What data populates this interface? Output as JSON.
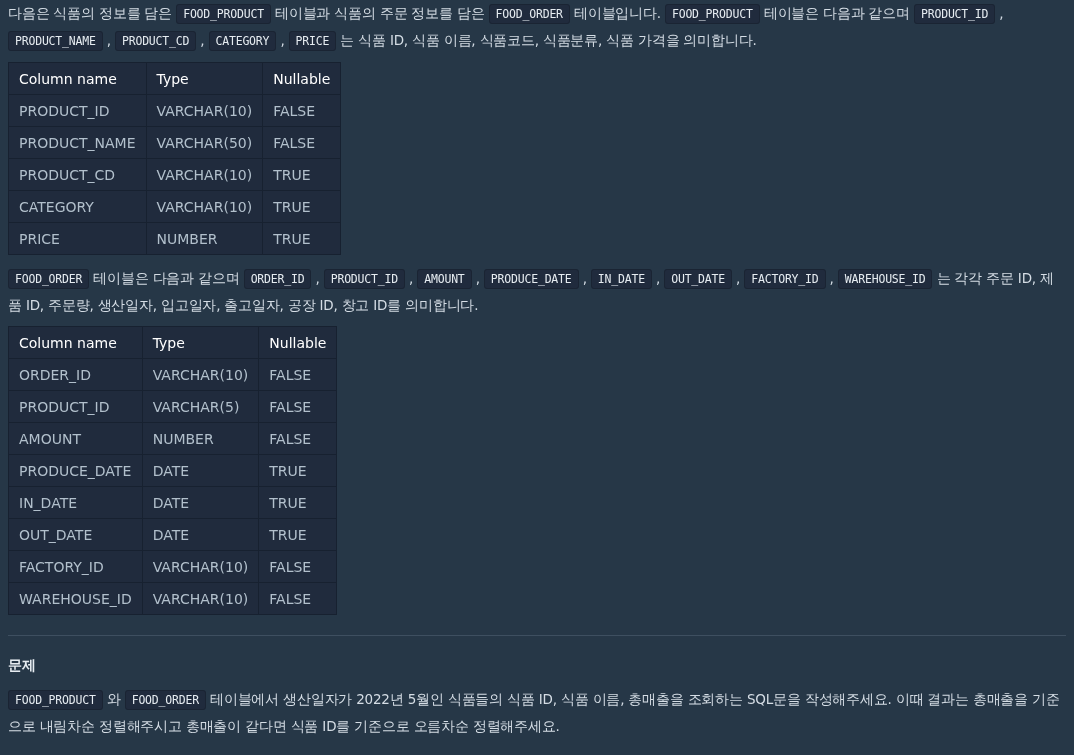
{
  "intro_1": [
    {
      "kind": "text",
      "text": "다음은 식품의 정보를 담은 "
    },
    {
      "kind": "code",
      "text": "FOOD_PRODUCT"
    },
    {
      "kind": "text",
      "text": " 테이블과 식품의 주문 정보를 담은 "
    },
    {
      "kind": "code",
      "text": "FOOD_ORDER"
    },
    {
      "kind": "text",
      "text": " 테이블입니다. "
    },
    {
      "kind": "code",
      "text": "FOOD_PRODUCT"
    },
    {
      "kind": "text",
      "text": " 테이블은 다음과 같으며 "
    },
    {
      "kind": "code",
      "text": "PRODUCT_ID"
    },
    {
      "kind": "text",
      "text": " , "
    },
    {
      "kind": "code",
      "text": "PRODUCT_NAME"
    },
    {
      "kind": "text",
      "text": " , "
    },
    {
      "kind": "code",
      "text": "PRODUCT_CD"
    },
    {
      "kind": "text",
      "text": " , "
    },
    {
      "kind": "code",
      "text": "CATEGORY"
    },
    {
      "kind": "text",
      "text": " , "
    },
    {
      "kind": "code",
      "text": "PRICE"
    },
    {
      "kind": "text",
      "text": " 는 식품 ID, 식품 이름, 식품코드, 식품분류, 식품 가격을 의미합니다."
    }
  ],
  "table_1": {
    "columns": [
      "Column name",
      "Type",
      "Nullable"
    ],
    "rows": [
      [
        "PRODUCT_ID",
        "VARCHAR(10)",
        "FALSE"
      ],
      [
        "PRODUCT_NAME",
        "VARCHAR(50)",
        "FALSE"
      ],
      [
        "PRODUCT_CD",
        "VARCHAR(10)",
        "TRUE"
      ],
      [
        "CATEGORY",
        "VARCHAR(10)",
        "TRUE"
      ],
      [
        "PRICE",
        "NUMBER",
        "TRUE"
      ]
    ]
  },
  "intro_2": [
    {
      "kind": "code",
      "text": "FOOD_ORDER"
    },
    {
      "kind": "text",
      "text": " 테이블은 다음과 같으며 "
    },
    {
      "kind": "code",
      "text": "ORDER_ID"
    },
    {
      "kind": "text",
      "text": " , "
    },
    {
      "kind": "code",
      "text": "PRODUCT_ID"
    },
    {
      "kind": "text",
      "text": " , "
    },
    {
      "kind": "code",
      "text": "AMOUNT"
    },
    {
      "kind": "text",
      "text": " , "
    },
    {
      "kind": "code",
      "text": "PRODUCE_DATE"
    },
    {
      "kind": "text",
      "text": " , "
    },
    {
      "kind": "code",
      "text": "IN_DATE"
    },
    {
      "kind": "text",
      "text": " , "
    },
    {
      "kind": "code",
      "text": "OUT_DATE"
    },
    {
      "kind": "text",
      "text": " , "
    },
    {
      "kind": "code",
      "text": "FACTORY_ID"
    },
    {
      "kind": "text",
      "text": " , "
    },
    {
      "kind": "code",
      "text": "WAREHOUSE_ID"
    },
    {
      "kind": "text",
      "text": " 는 각각 주문 ID, 제품 ID, 주문량, 생산일자, 입고일자, 출고일자, 공장 ID, 창고 ID를 의미합니다."
    }
  ],
  "table_2": {
    "columns": [
      "Column name",
      "Type",
      "Nullable"
    ],
    "rows": [
      [
        "ORDER_ID",
        "VARCHAR(10)",
        "FALSE"
      ],
      [
        "PRODUCT_ID",
        "VARCHAR(5)",
        "FALSE"
      ],
      [
        "AMOUNT",
        "NUMBER",
        "FALSE"
      ],
      [
        "PRODUCE_DATE",
        "DATE",
        "TRUE"
      ],
      [
        "IN_DATE",
        "DATE",
        "TRUE"
      ],
      [
        "OUT_DATE",
        "DATE",
        "TRUE"
      ],
      [
        "FACTORY_ID",
        "VARCHAR(10)",
        "FALSE"
      ],
      [
        "WAREHOUSE_ID",
        "VARCHAR(10)",
        "FALSE"
      ]
    ]
  },
  "section_heading": "문제",
  "problem": [
    {
      "kind": "code",
      "text": "FOOD_PRODUCT"
    },
    {
      "kind": "text",
      "text": " 와 "
    },
    {
      "kind": "code",
      "text": "FOOD_ORDER"
    },
    {
      "kind": "text",
      "text": " 테이블에서 생산일자가 2022년 5월인 식품들의 식품 ID, 식품 이름, 총매출을 조회하는 SQL문을 작성해주세요. 이때 결과는 총매출을 기준으로 내림차순 정렬해주시고 총매출이 같다면 식품 ID를 기준으로 오름차순 정렬해주세요."
    }
  ]
}
